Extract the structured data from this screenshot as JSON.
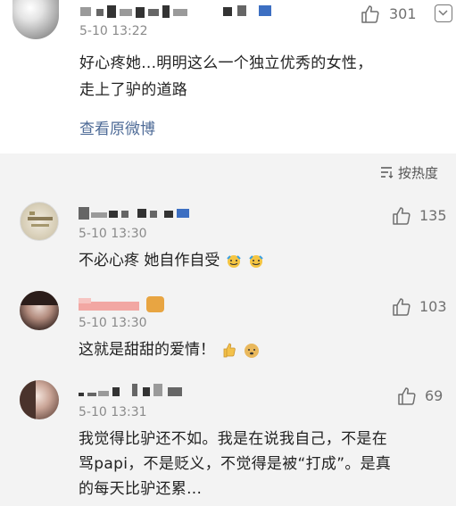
{
  "top_post": {
    "time": "5-10 13:22",
    "text_line1": "好心疼她...明明这么一个独立优秀的女性，",
    "text_line2": "走上了驴的道路",
    "view_original": "查看原微博",
    "like_count": "301"
  },
  "sort": {
    "label": "按热度"
  },
  "comments": [
    {
      "time": "5-10 13:30",
      "text": "不必心疼 她自作自受",
      "like_count": "135"
    },
    {
      "time": "5-10 13:30",
      "text": "这就是甜甜的爱情！",
      "like_count": "103"
    },
    {
      "time": "5-10 13:31",
      "text_line1": "我觉得比驴还不如。我是在说我自己，不是在",
      "text_line2": "骂papi，不是贬义，不觉得是被“打成”。是真",
      "text_line3": "的每天比驴还累...",
      "like_count": "69"
    }
  ],
  "colors": {
    "link": "#4e6b97",
    "background_gray": "#f3f3f3",
    "time_gray": "#8a8a8a"
  },
  "icons": [
    "thumbs-up-icon",
    "chevron-down-icon",
    "sort-icon"
  ]
}
